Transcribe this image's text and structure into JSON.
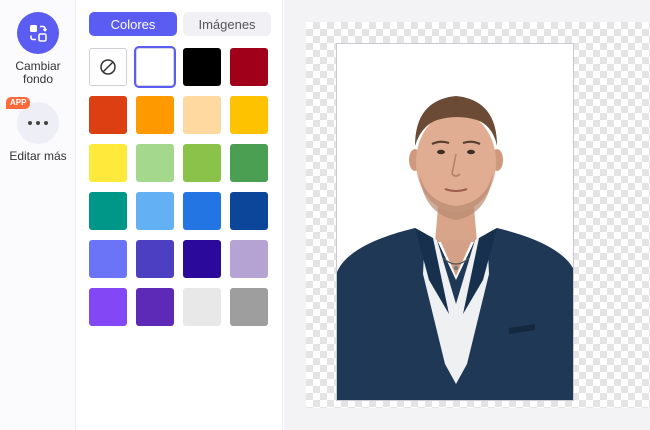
{
  "sidebar": {
    "tools": [
      {
        "label": "Cambiar fondo",
        "icon": "swap-background-icon"
      },
      {
        "label": "Editar más",
        "icon": "more-dots-icon",
        "badge": "APP"
      }
    ]
  },
  "panel": {
    "tabs": [
      {
        "label": "Colores",
        "active": true
      },
      {
        "label": "Imágenes",
        "active": false
      }
    ],
    "swatches": [
      "none",
      "#ffffff",
      "#000000",
      "#a0001a",
      "#dc3f12",
      "#ff9900",
      "#ffd9a0",
      "#ffc200",
      "#ffe93a",
      "#a4d88d",
      "#8bc34a",
      "#4a9f52",
      "#009688",
      "#64b0f5",
      "#2275e3",
      "#0c469b",
      "#6b74f6",
      "#4d3fc1",
      "#2b0a9b",
      "#b4a3d3",
      "#8447f5",
      "#5d2ab8",
      "#e8e8e8",
      "#9e9e9e"
    ],
    "selected_swatch": "#ffffff"
  },
  "canvas": {
    "background": "transparent-checkerboard",
    "photo_background": "#ffffff",
    "subject": "man in navy suit and white shirt"
  },
  "colors": {
    "accent": "#5b5cf2",
    "badge": "#ff6a3d"
  }
}
